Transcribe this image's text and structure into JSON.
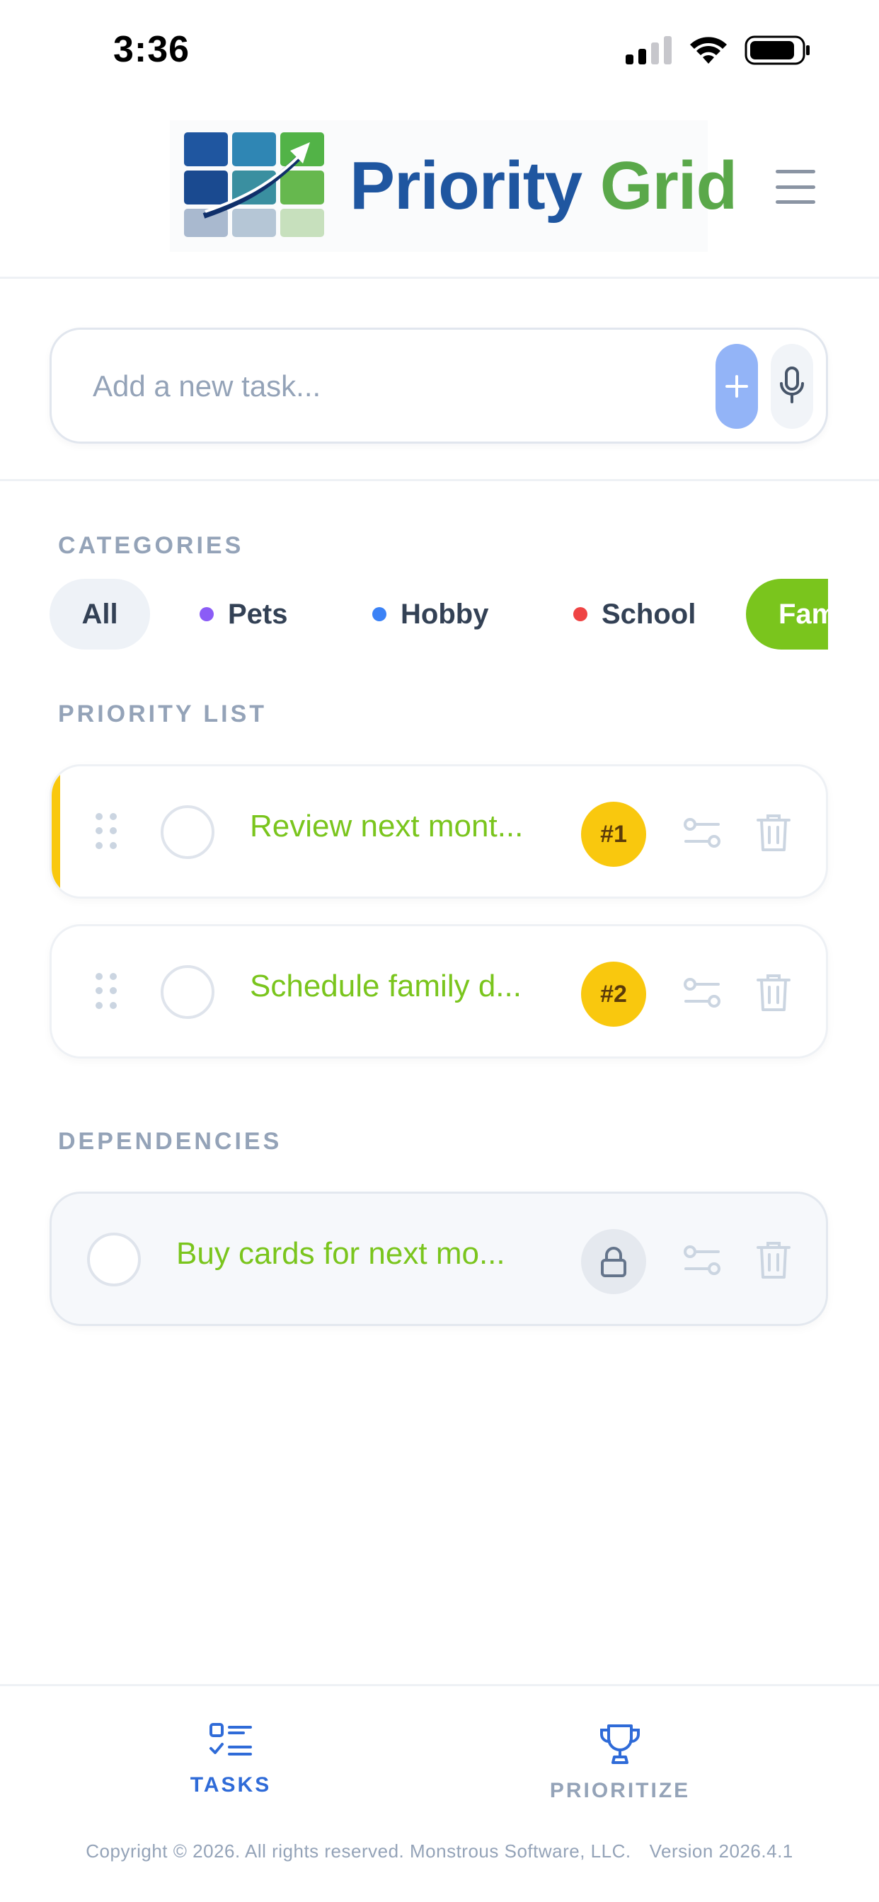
{
  "status_bar": {
    "time": "3:36"
  },
  "header": {
    "logo_word1": "Priority",
    "logo_word2": "Grid"
  },
  "add_task": {
    "placeholder": "Add a new task...",
    "add_symbol": "+"
  },
  "categories": {
    "title": "CATEGORIES",
    "items": [
      {
        "label": "All",
        "color": ""
      },
      {
        "label": "Pets",
        "color": "#8b5cf6"
      },
      {
        "label": "Hobby",
        "color": "#3b82f6"
      },
      {
        "label": "School",
        "color": "#ef4444"
      },
      {
        "label": "Fam",
        "color": "#7ac51d"
      }
    ]
  },
  "priority_list": {
    "title": "PRIORITY LIST",
    "tasks": [
      {
        "text": "Review next mont...",
        "rank": "#1"
      },
      {
        "text": "Schedule family d...",
        "rank": "#2"
      }
    ]
  },
  "dependencies": {
    "title": "DEPENDENCIES",
    "tasks": [
      {
        "text": "Buy cards for next mo..."
      }
    ]
  },
  "bottom_nav": {
    "tasks_label": "TASKS",
    "prioritize_label": "PRIORITIZE"
  },
  "footer": {
    "copyright": "Copyright © 2026. All rights reserved. Monstrous Software, LLC.",
    "version": "Version 2026.4.1"
  },
  "colors": {
    "accent_blue": "#2f6bd8",
    "accent_green": "#7ac51d",
    "rank_yellow": "#f9c80e"
  }
}
